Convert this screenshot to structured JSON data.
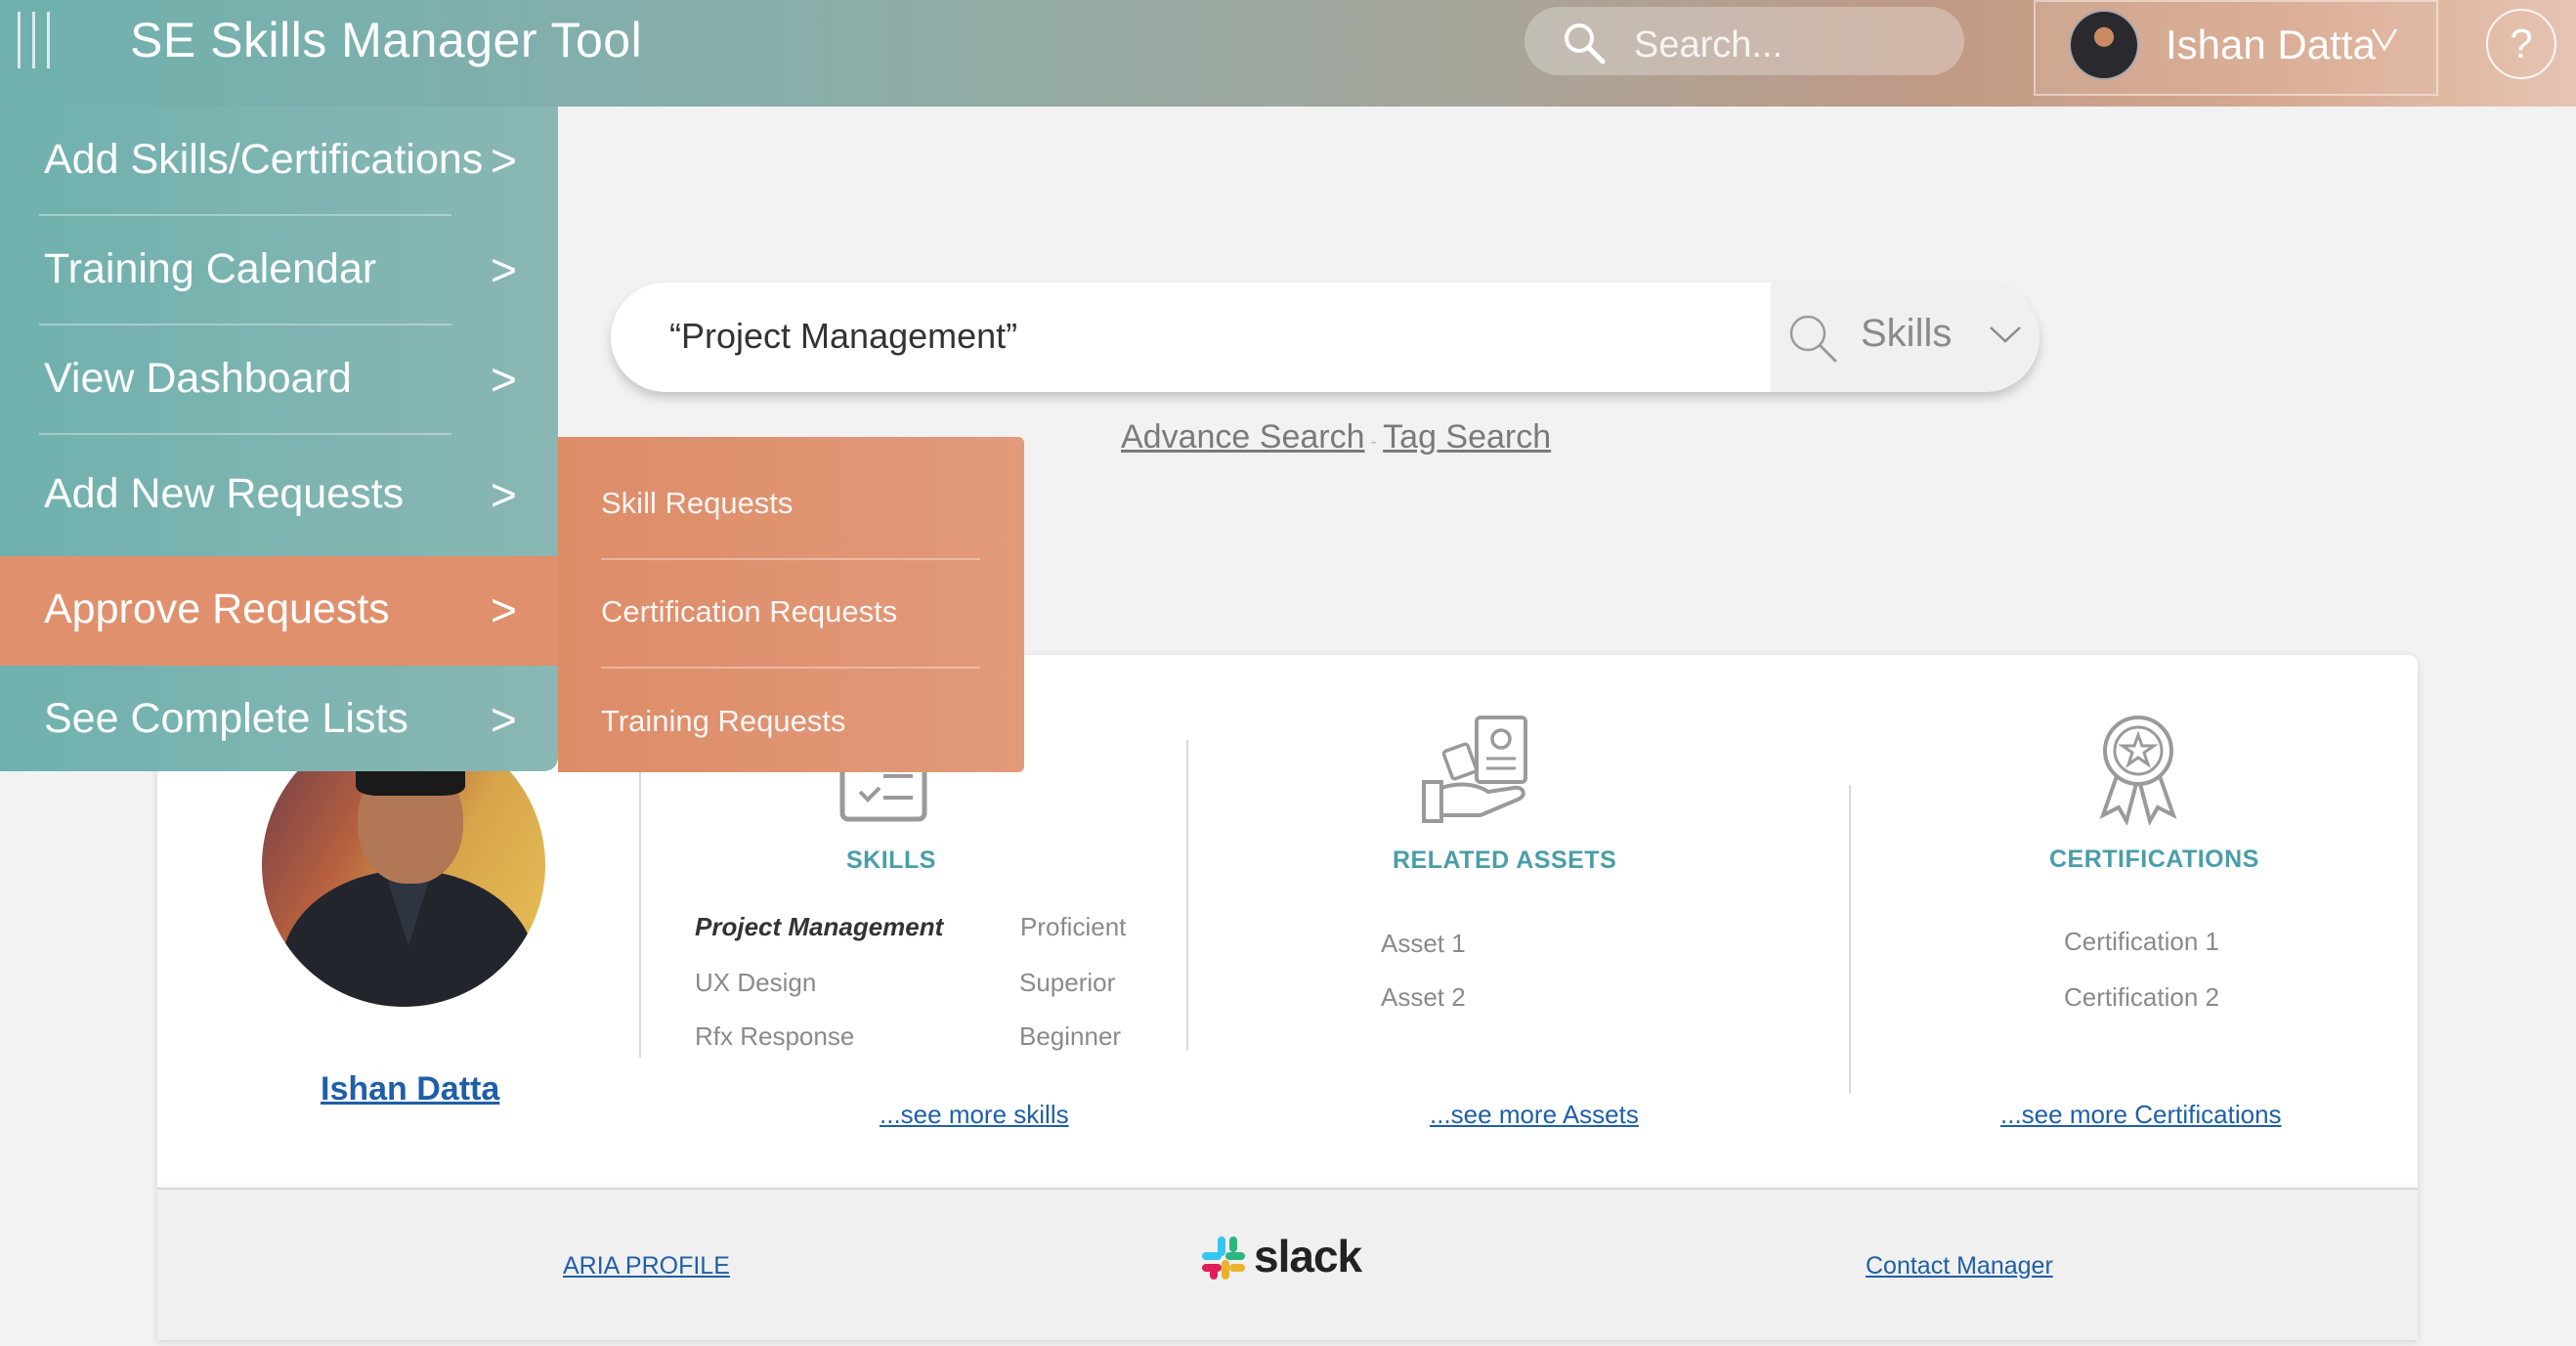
{
  "header": {
    "title": "SE Skills Manager Tool",
    "search_placeholder": "Search...",
    "user_name": "Ishan Datta",
    "user_chevron": "∨",
    "help_label": "?"
  },
  "side_menu": {
    "items": [
      {
        "label": "Add Skills/Certifications",
        "arrow": ">"
      },
      {
        "label": "Training Calendar",
        "arrow": ">"
      },
      {
        "label": "View Dashboard",
        "arrow": ">"
      },
      {
        "label": "Add New Requests",
        "arrow": ">"
      },
      {
        "label": "Approve Requests",
        "arrow": ">"
      },
      {
        "label": "See Complete Lists",
        "arrow": ">"
      }
    ],
    "active_item": "Approve Requests",
    "submenu": [
      "Skill Requests",
      "Certification Requests",
      "Training Requests"
    ]
  },
  "main_search": {
    "query": "“Project Management”",
    "scope": "Skills",
    "advance_search": "Advance Search",
    "tag_search": "Tag Search",
    "separator": "-"
  },
  "profile": {
    "name": "Ishan Datta",
    "skills": {
      "title": "SKILLS",
      "items": [
        {
          "name": "Project Management",
          "level": "Proficient"
        },
        {
          "name": "UX Design",
          "level": "Superior"
        },
        {
          "name": "Rfx Response",
          "level": "Beginner"
        }
      ],
      "more": "...see more skills"
    },
    "assets": {
      "title": "RELATED ASSETS",
      "items": [
        "Asset 1",
        "Asset 2"
      ],
      "more": "...see more Assets"
    },
    "certifications": {
      "title": "CERTIFICATIONS",
      "items": [
        "Certification 1",
        "Certification 2"
      ],
      "more": "...see more Certifications"
    }
  },
  "footer": {
    "aria_profile": "ARIA PROFILE",
    "slack": "slack",
    "contact_manager": "Contact Manager"
  },
  "colors": {
    "teal": "#6fb1ae",
    "orange": "#e0906c",
    "link_blue": "#1f5fa8",
    "section_title": "#4a9ea8"
  }
}
